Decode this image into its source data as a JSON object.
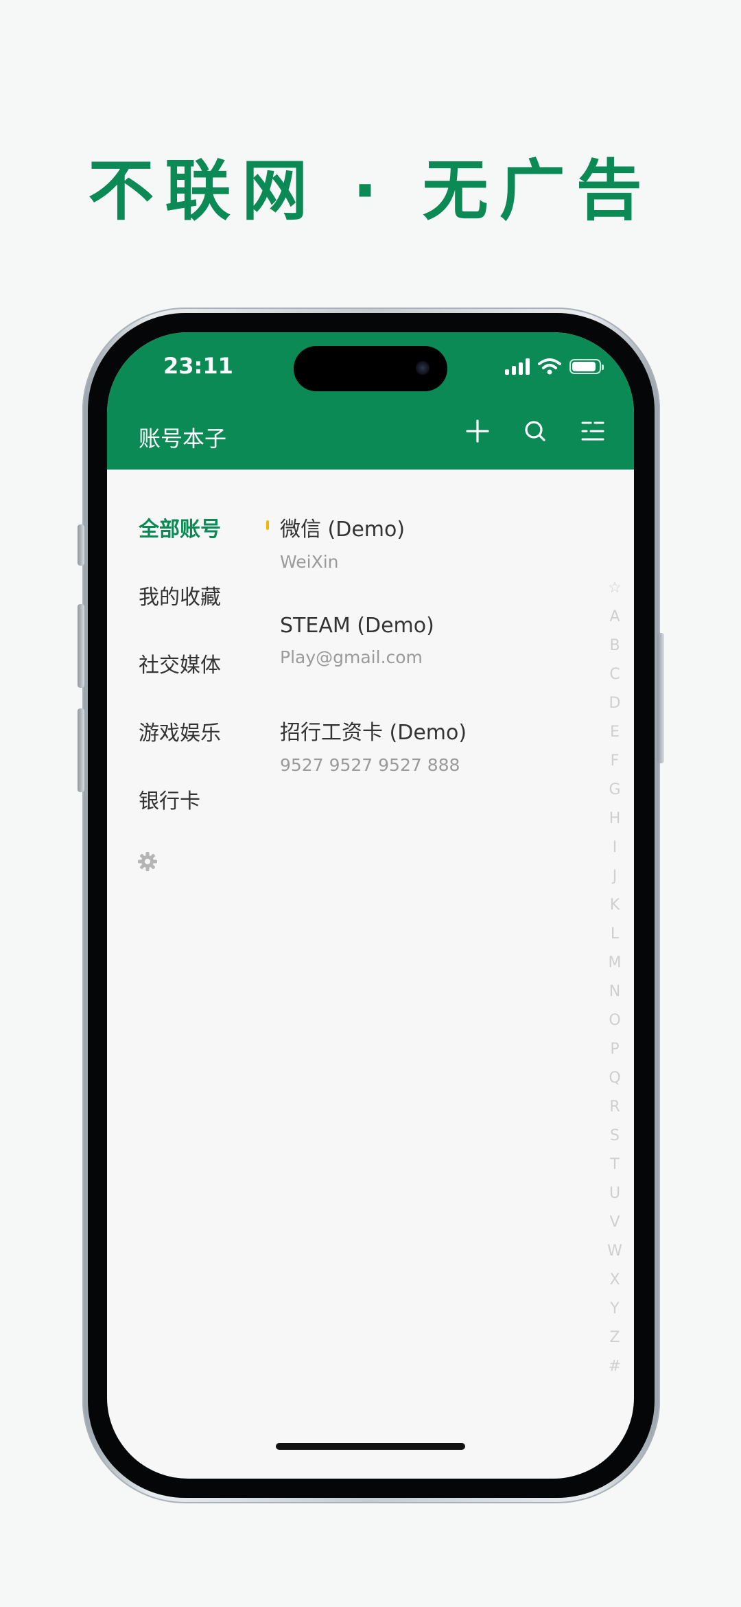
{
  "headline": "不联网 · 无广告",
  "status_bar": {
    "time": "23:11"
  },
  "app_bar": {
    "title": "账号本子",
    "actions": [
      "add-icon",
      "search-icon",
      "list-menu-icon"
    ]
  },
  "categories": [
    {
      "label": "全部账号",
      "active": true
    },
    {
      "label": "我的收藏",
      "active": false
    },
    {
      "label": "社交媒体",
      "active": false
    },
    {
      "label": "游戏娱乐",
      "active": false
    },
    {
      "label": "银行卡",
      "active": false
    }
  ],
  "entries": [
    {
      "name": "微信 (Demo)",
      "sub": "WeiXin",
      "favorite": true
    },
    {
      "name": "STEAM (Demo)",
      "sub": "Play@gmail.com",
      "favorite": false
    },
    {
      "name": "招行工资卡 (Demo)",
      "sub": "9527 9527 9527 888",
      "favorite": false
    }
  ],
  "alphabet_index": [
    "☆",
    "A",
    "B",
    "C",
    "D",
    "E",
    "F",
    "G",
    "H",
    "I",
    "J",
    "K",
    "L",
    "M",
    "N",
    "O",
    "P",
    "Q",
    "R",
    "S",
    "T",
    "U",
    "V",
    "W",
    "X",
    "Y",
    "Z",
    "#"
  ],
  "colors": {
    "brand": "#0b8a55",
    "favorite_marker": "#f2b705"
  }
}
